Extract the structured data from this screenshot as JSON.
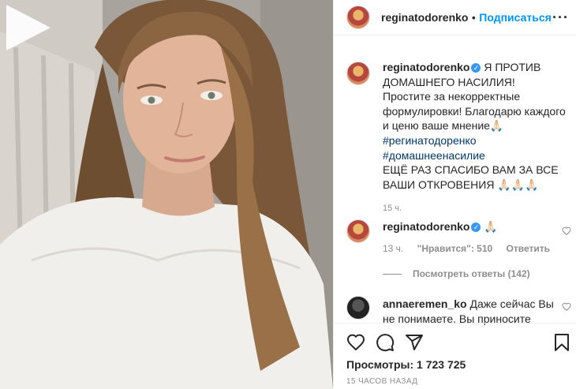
{
  "header": {
    "username": "reginatodorenko",
    "separator": "•",
    "follow_label": "Подписаться",
    "more_label": "···"
  },
  "caption": {
    "username": "reginatodorenko",
    "text_lines": [
      "Я ПРОТИВ",
      "ДОМАШНЕГО НАСИЛИЯ!",
      "Простите за некорректные",
      "формулировки! Благодарю каждого",
      "и ценю ваше мнение🙏🏻"
    ],
    "hashtags": [
      "#регинатодоренко",
      "#домашнеенасилие"
    ],
    "text_after": [
      "ЕЩЁ РАЗ СПАСИБО ВАМ ЗА ВСЕ",
      "ВАШИ ОТКРОВЕНИЯ 🙏🏻🙏🏻🙏🏻"
    ],
    "time": "15 ч."
  },
  "comments": [
    {
      "username": "reginatodorenko",
      "text": "🙏🏻",
      "time": "13 ч.",
      "likes": "\"Нравится\": 510",
      "reply_label": "Ответить",
      "view_replies": "Посмотреть ответы (142)"
    },
    {
      "username": "annaeremen_ko",
      "text_line1": "Даже сейчас Вы",
      "text_line2": "не понимаете. Вы приносите"
    }
  ],
  "footer": {
    "views": "Просмотры: 1 723 725",
    "ago": "15 ЧАСОВ НАЗАД"
  },
  "icons": [
    "heart-icon",
    "comment-icon",
    "share-icon",
    "bookmark-icon",
    "play-icon",
    "verified-icon",
    "more-icon"
  ]
}
